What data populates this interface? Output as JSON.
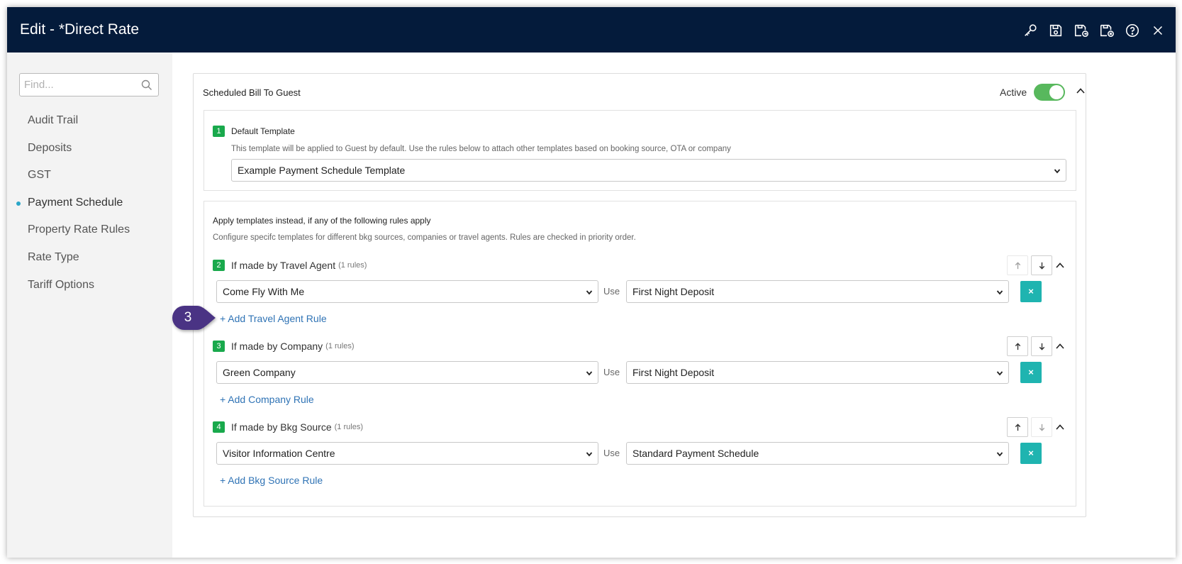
{
  "window": {
    "title": "Edit - *Direct Rate"
  },
  "toolbar": {
    "icons": [
      "key-icon",
      "save-icon",
      "save-and-new-icon",
      "save-and-close-icon",
      "help-icon",
      "close-icon"
    ]
  },
  "sidebar": {
    "search_placeholder": "Find...",
    "items": [
      {
        "label": "Audit Trail"
      },
      {
        "label": "Deposits"
      },
      {
        "label": "GST"
      },
      {
        "label": "Payment Schedule",
        "active": true
      },
      {
        "label": "Property Rate Rules"
      },
      {
        "label": "Rate Type"
      },
      {
        "label": "Tariff Options"
      }
    ]
  },
  "panel": {
    "title": "Scheduled Bill To Guest",
    "active_label": "Active",
    "active": true,
    "default_template": {
      "badge": "1",
      "label": "Default Template",
      "description": "This template will be applied to Guest by default. Use the rules below to attach other templates based on booking source, OTA or company",
      "selected": "Example Payment Schedule Template"
    },
    "rules_section": {
      "title": "Apply templates instead, if any of the following rules apply",
      "description": "Configure specifc templates for different bkg sources, companies or travel agents. Rules are checked in priority order.",
      "use_label": "Use",
      "delete_label": "×",
      "groups": [
        {
          "badge": "2",
          "label": "If made by Travel Agent",
          "count": "(1 rules)",
          "value": "Come Fly With Me",
          "template": "First Night Deposit",
          "add_label": "+ Add Travel Agent Rule"
        },
        {
          "badge": "3",
          "label": "If made by Company",
          "count": "(1 rules)",
          "value": "Green Company",
          "template": "First Night Deposit",
          "add_label": "+ Add Company Rule"
        },
        {
          "badge": "4",
          "label": "If made by Bkg Source",
          "count": "(1 rules)",
          "value": "Visitor Information Centre",
          "template": "Standard Payment Schedule",
          "add_label": "+ Add Bkg Source Rule"
        }
      ]
    }
  },
  "callout": {
    "number": "3",
    "color": "#4a3384"
  },
  "colors": {
    "titlebar": "#041b3b",
    "badge": "#19a94c",
    "toggle": "#58b85d",
    "delete": "#1fb4b0",
    "link": "#2f73b5"
  }
}
